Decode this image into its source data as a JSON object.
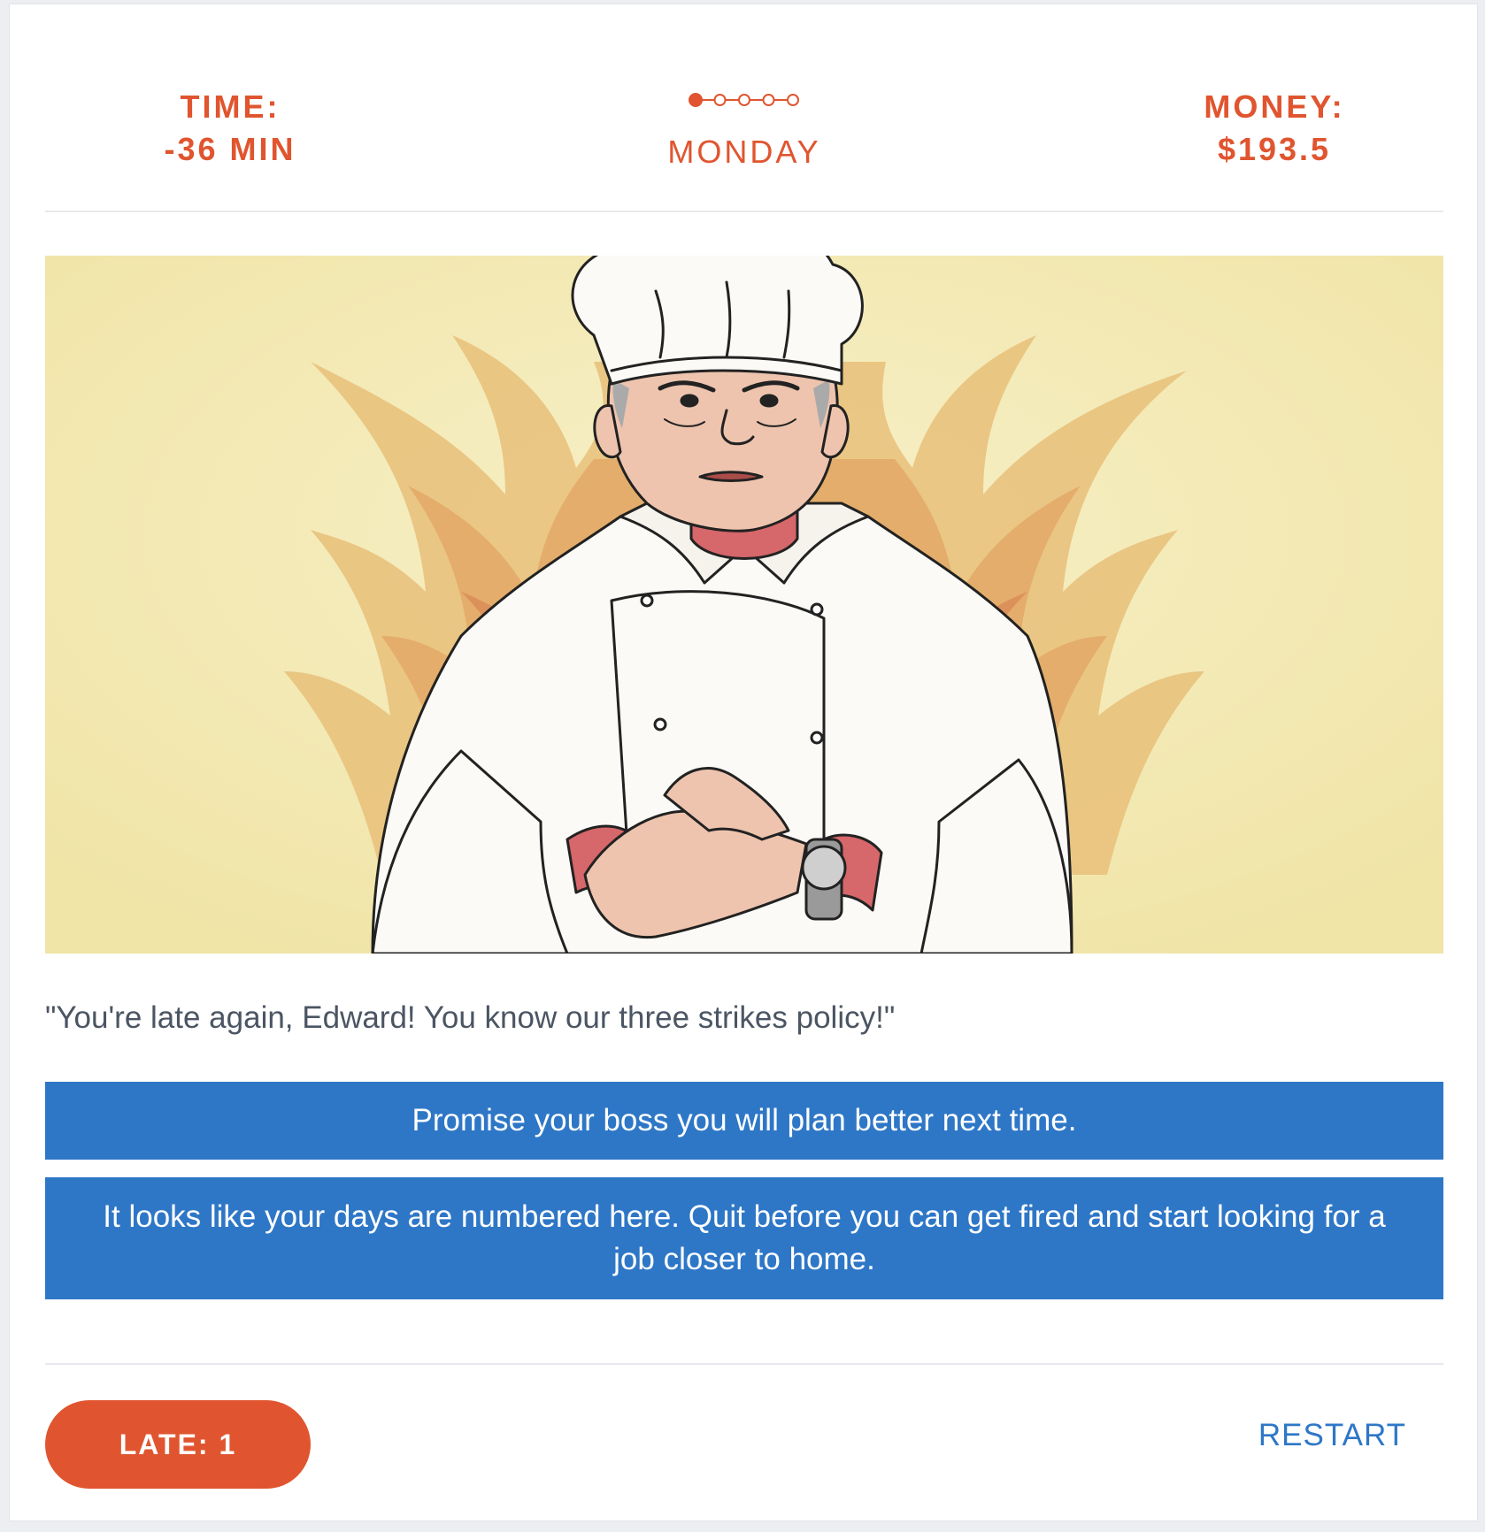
{
  "status": {
    "time_label": "TIME:",
    "time_value": "-36 MIN",
    "day_label": "MONDAY",
    "money_label": "MONEY:",
    "money_value": "$193.5"
  },
  "week_progress": {
    "total_days": 5,
    "current_day": 1
  },
  "scene": {
    "character_icon": "angry-chef-pointing-at-watch",
    "background_icon": "flames"
  },
  "dialogue": "\"You're late again, Edward! You know our three strikes policy!\"",
  "choices": [
    {
      "label": "Promise your boss you will plan better next time."
    },
    {
      "label": "It looks like your days are numbered here. Quit before you can get fired and start looking for a job closer to home."
    }
  ],
  "footer": {
    "late_label": "LATE: 1",
    "restart_label": "RESTART"
  },
  "colors": {
    "accent_orange": "#e0552f",
    "choice_blue": "#2e77c7",
    "scene_bg": "#f3ebb6"
  }
}
